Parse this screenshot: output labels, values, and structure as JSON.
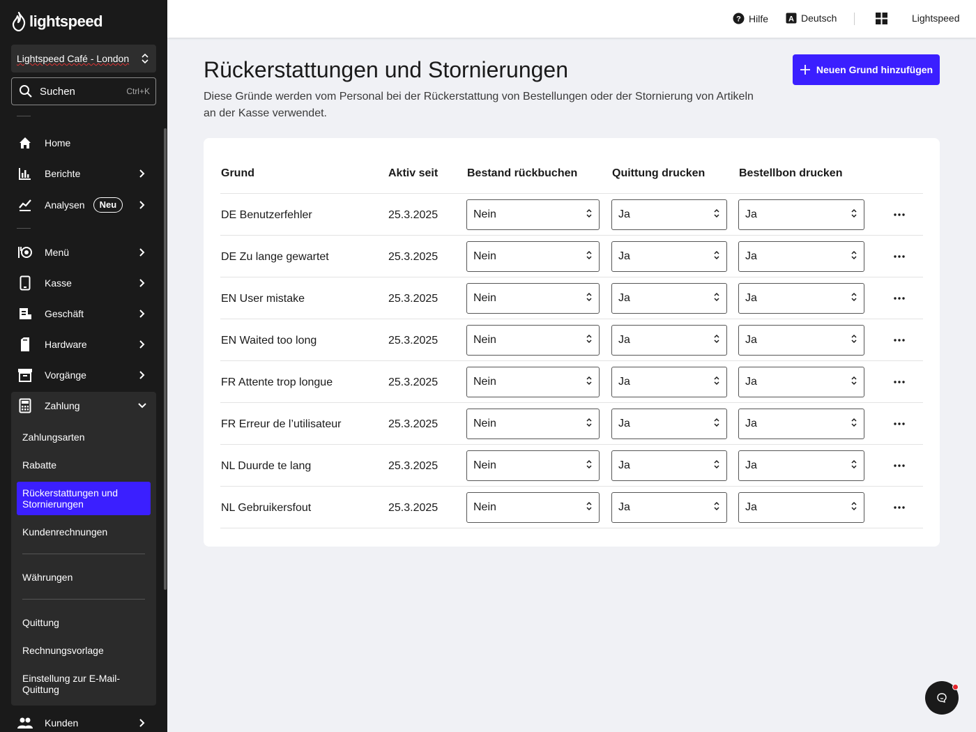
{
  "app": {
    "brand": "lightspeed"
  },
  "sidebar": {
    "store": "Lightspeed Café - London",
    "search": {
      "label": "Suchen",
      "shortcut": "Ctrl+K"
    },
    "items": [
      {
        "label": "Home",
        "icon": "home-icon"
      },
      {
        "label": "Berichte",
        "icon": "bar-chart-icon"
      },
      {
        "label": "Analysen",
        "icon": "trend-icon",
        "badge": "Neu"
      },
      {
        "label": "Menü",
        "icon": "menu-book-icon"
      },
      {
        "label": "Kasse",
        "icon": "tablet-icon"
      },
      {
        "label": "Geschäft",
        "icon": "store-icon"
      },
      {
        "label": "Hardware",
        "icon": "printer-icon"
      },
      {
        "label": "Vorgänge",
        "icon": "archive-icon"
      },
      {
        "label": "Zahlung",
        "icon": "calculator-icon"
      },
      {
        "label": "Kunden",
        "icon": "people-icon"
      }
    ],
    "payment_sub": [
      "Zahlungsarten",
      "Rabatte",
      "Rückerstattungen und Stornierungen",
      "Kundenrechnungen",
      "Währungen",
      "Quittung",
      "Rechnungsvorlage",
      "Einstellung zur E-Mail-Quittung"
    ]
  },
  "topbar": {
    "help": "Hilfe",
    "language": "Deutsch",
    "account": "Lightspeed"
  },
  "page": {
    "title": "Rückerstattungen und Stornierungen",
    "description": "Diese Gründe werden vom Personal bei der Rückerstattung von Bestellungen oder der Stornierung von Artikeln an der Kasse verwendet.",
    "add_button": "Neuen Grund hinzufügen"
  },
  "table": {
    "headers": [
      "Grund",
      "Aktiv seit",
      "Bestand rückbuchen",
      "Quittung drucken",
      "Bestellbon drucken"
    ],
    "rows": [
      {
        "reason": "DE Benutzerfehler",
        "since": "25.3.2025",
        "restock": "Nein",
        "receipt": "Ja",
        "order_ticket": "Ja"
      },
      {
        "reason": "DE Zu lange gewartet",
        "since": "25.3.2025",
        "restock": "Nein",
        "receipt": "Ja",
        "order_ticket": "Ja"
      },
      {
        "reason": "EN User mistake",
        "since": "25.3.2025",
        "restock": "Nein",
        "receipt": "Ja",
        "order_ticket": "Ja"
      },
      {
        "reason": "EN Waited too long",
        "since": "25.3.2025",
        "restock": "Nein",
        "receipt": "Ja",
        "order_ticket": "Ja"
      },
      {
        "reason": "FR Attente trop longue",
        "since": "25.3.2025",
        "restock": "Nein",
        "receipt": "Ja",
        "order_ticket": "Ja"
      },
      {
        "reason": "FR Erreur de l’utilisateur",
        "since": "25.3.2025",
        "restock": "Nein",
        "receipt": "Ja",
        "order_ticket": "Ja"
      },
      {
        "reason": "NL Duurde te lang",
        "since": "25.3.2025",
        "restock": "Nein",
        "receipt": "Ja",
        "order_ticket": "Ja"
      },
      {
        "reason": "NL Gebruikersfout",
        "since": "25.3.2025",
        "restock": "Nein",
        "receipt": "Ja",
        "order_ticket": "Ja"
      }
    ]
  },
  "colors": {
    "accent": "#3b1fff",
    "sidebar_bg": "#1a1a1a",
    "page_bg": "#f0f1f5",
    "notification": "#e5262d"
  }
}
